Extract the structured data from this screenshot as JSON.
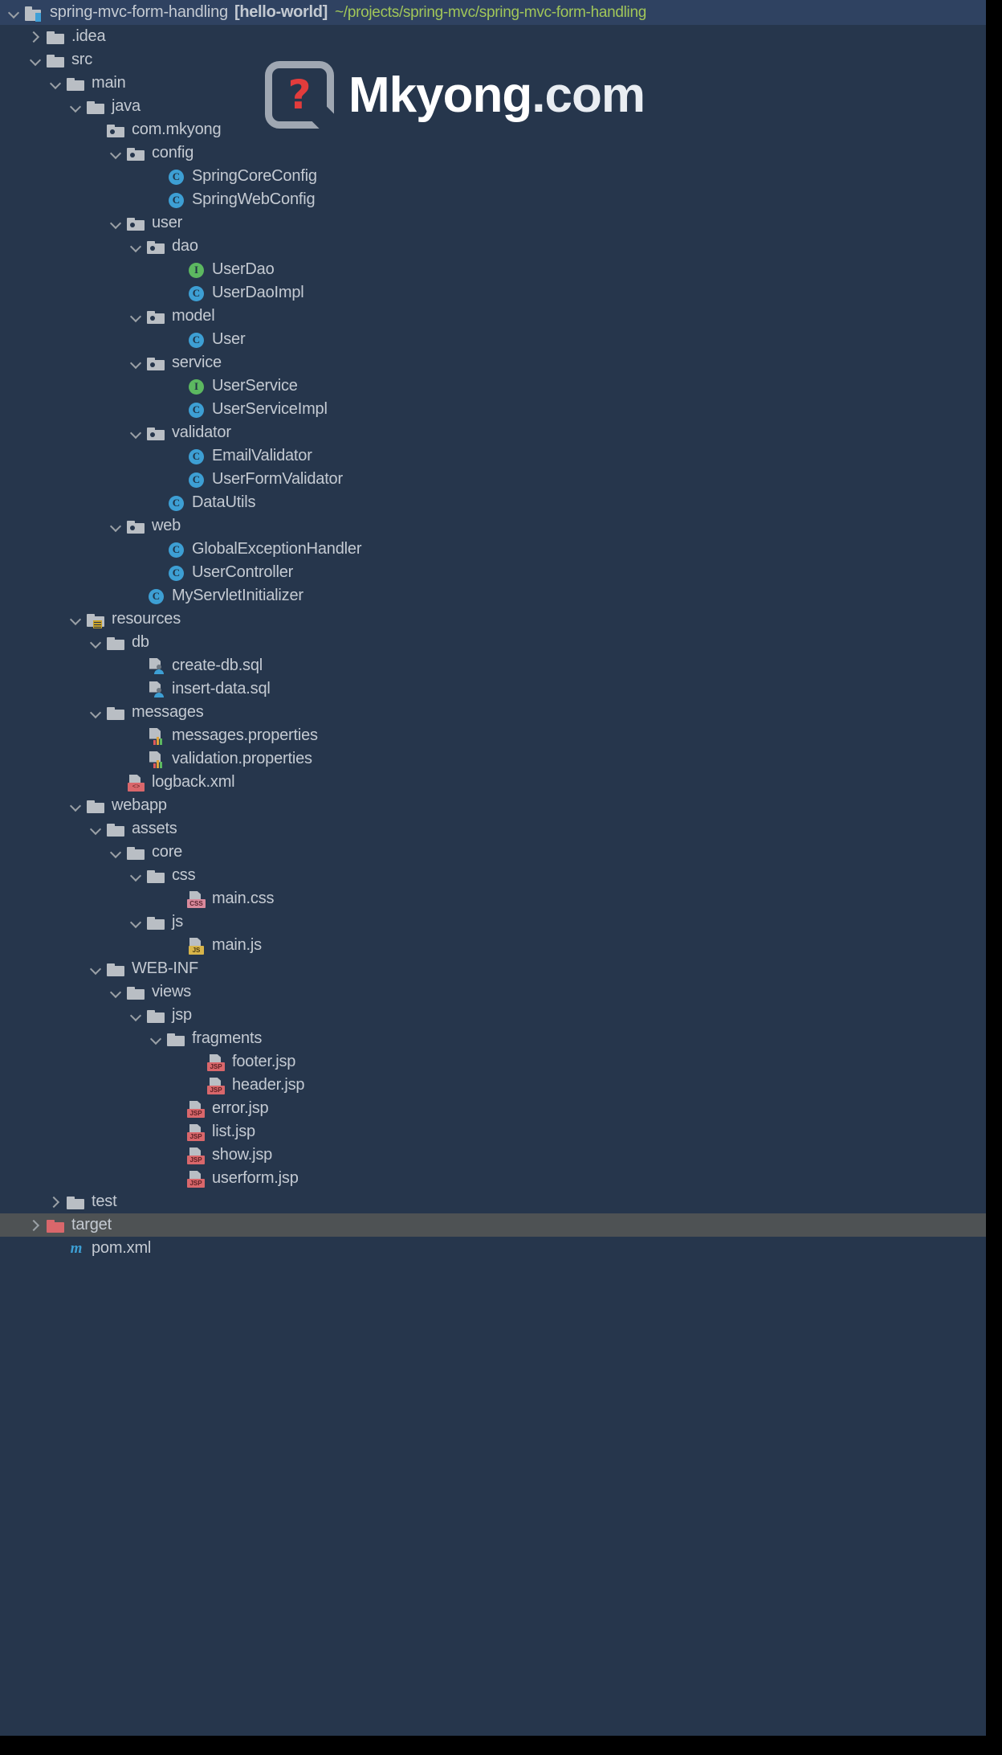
{
  "header": {
    "chevron": "chevron-down",
    "icon": "project-module-icon",
    "project_name": "spring-mvc-form-handling",
    "module": "[hello-world]",
    "path": "~/projects/spring-mvc/spring-mvc-form-handling"
  },
  "watermark": {
    "glyph": "?",
    "brand": "Mkyong",
    "suffix": ".com"
  },
  "colors": {
    "panel_bg": "#26364c",
    "title_bg": "#2f4261",
    "selected_bg": "#4e5254",
    "text": "#c4cad2",
    "path_green": "#a1c659",
    "class_blue": "#3d9fd4",
    "interface_green": "#5cb860",
    "folder_gray": "#b9bec4",
    "target_red": "#d9676b"
  },
  "tree": [
    {
      "label": ".idea",
      "indent": 1,
      "chevron": "right",
      "icon": "folder",
      "selected": false
    },
    {
      "label": "src",
      "indent": 1,
      "chevron": "down",
      "icon": "folder",
      "selected": false
    },
    {
      "label": "main",
      "indent": 2,
      "chevron": "down",
      "icon": "folder",
      "selected": false
    },
    {
      "label": "java",
      "indent": 3,
      "chevron": "down",
      "icon": "folder",
      "selected": false
    },
    {
      "label": "com.mkyong",
      "indent": 4,
      "chevron": "none",
      "icon": "package",
      "selected": false
    },
    {
      "label": "config",
      "indent": 5,
      "chevron": "down",
      "icon": "package",
      "selected": false
    },
    {
      "label": "SpringCoreConfig",
      "indent": 7,
      "chevron": "none",
      "icon": "class",
      "selected": false
    },
    {
      "label": "SpringWebConfig",
      "indent": 7,
      "chevron": "none",
      "icon": "class",
      "selected": false
    },
    {
      "label": "user",
      "indent": 5,
      "chevron": "down",
      "icon": "package",
      "selected": false
    },
    {
      "label": "dao",
      "indent": 6,
      "chevron": "down",
      "icon": "package",
      "selected": false
    },
    {
      "label": "UserDao",
      "indent": 8,
      "chevron": "none",
      "icon": "interface",
      "selected": false
    },
    {
      "label": "UserDaoImpl",
      "indent": 8,
      "chevron": "none",
      "icon": "class",
      "selected": false
    },
    {
      "label": "model",
      "indent": 6,
      "chevron": "down",
      "icon": "package",
      "selected": false
    },
    {
      "label": "User",
      "indent": 8,
      "chevron": "none",
      "icon": "class",
      "selected": false
    },
    {
      "label": "service",
      "indent": 6,
      "chevron": "down",
      "icon": "package",
      "selected": false
    },
    {
      "label": "UserService",
      "indent": 8,
      "chevron": "none",
      "icon": "interface",
      "selected": false
    },
    {
      "label": "UserServiceImpl",
      "indent": 8,
      "chevron": "none",
      "icon": "class",
      "selected": false
    },
    {
      "label": "validator",
      "indent": 6,
      "chevron": "down",
      "icon": "package",
      "selected": false
    },
    {
      "label": "EmailValidator",
      "indent": 8,
      "chevron": "none",
      "icon": "class",
      "selected": false
    },
    {
      "label": "UserFormValidator",
      "indent": 8,
      "chevron": "none",
      "icon": "class",
      "selected": false
    },
    {
      "label": "DataUtils",
      "indent": 7,
      "chevron": "none",
      "icon": "class",
      "selected": false
    },
    {
      "label": "web",
      "indent": 5,
      "chevron": "down",
      "icon": "package",
      "selected": false
    },
    {
      "label": "GlobalExceptionHandler",
      "indent": 7,
      "chevron": "none",
      "icon": "class",
      "selected": false
    },
    {
      "label": "UserController",
      "indent": 7,
      "chevron": "none",
      "icon": "class",
      "selected": false
    },
    {
      "label": "MyServletInitializer",
      "indent": 6,
      "chevron": "none",
      "icon": "class",
      "selected": false
    },
    {
      "label": "resources",
      "indent": 3,
      "chevron": "down",
      "icon": "resources",
      "selected": false
    },
    {
      "label": "db",
      "indent": 4,
      "chevron": "down",
      "icon": "folder",
      "selected": false
    },
    {
      "label": "create-db.sql",
      "indent": 6,
      "chevron": "none",
      "icon": "sql",
      "selected": false
    },
    {
      "label": "insert-data.sql",
      "indent": 6,
      "chevron": "none",
      "icon": "sql",
      "selected": false
    },
    {
      "label": "messages",
      "indent": 4,
      "chevron": "down",
      "icon": "folder",
      "selected": false
    },
    {
      "label": "messages.properties",
      "indent": 6,
      "chevron": "none",
      "icon": "properties",
      "selected": false
    },
    {
      "label": "validation.properties",
      "indent": 6,
      "chevron": "none",
      "icon": "properties",
      "selected": false
    },
    {
      "label": "logback.xml",
      "indent": 5,
      "chevron": "none",
      "icon": "xml",
      "selected": false
    },
    {
      "label": "webapp",
      "indent": 3,
      "chevron": "down",
      "icon": "folder",
      "selected": false
    },
    {
      "label": "assets",
      "indent": 4,
      "chevron": "down",
      "icon": "folder",
      "selected": false
    },
    {
      "label": "core",
      "indent": 5,
      "chevron": "down",
      "icon": "folder",
      "selected": false
    },
    {
      "label": "css",
      "indent": 6,
      "chevron": "down",
      "icon": "folder",
      "selected": false
    },
    {
      "label": "main.css",
      "indent": 8,
      "chevron": "none",
      "icon": "css",
      "selected": false
    },
    {
      "label": "js",
      "indent": 6,
      "chevron": "down",
      "icon": "folder",
      "selected": false
    },
    {
      "label": "main.js",
      "indent": 8,
      "chevron": "none",
      "icon": "js",
      "selected": false
    },
    {
      "label": "WEB-INF",
      "indent": 4,
      "chevron": "down",
      "icon": "folder",
      "selected": false
    },
    {
      "label": "views",
      "indent": 5,
      "chevron": "down",
      "icon": "folder",
      "selected": false
    },
    {
      "label": "jsp",
      "indent": 6,
      "chevron": "down",
      "icon": "folder",
      "selected": false
    },
    {
      "label": "fragments",
      "indent": 7,
      "chevron": "down",
      "icon": "folder",
      "selected": false
    },
    {
      "label": "footer.jsp",
      "indent": 9,
      "chevron": "none",
      "icon": "jsp",
      "selected": false
    },
    {
      "label": "header.jsp",
      "indent": 9,
      "chevron": "none",
      "icon": "jsp",
      "selected": false
    },
    {
      "label": "error.jsp",
      "indent": 8,
      "chevron": "none",
      "icon": "jsp",
      "selected": false
    },
    {
      "label": "list.jsp",
      "indent": 8,
      "chevron": "none",
      "icon": "jsp",
      "selected": false
    },
    {
      "label": "show.jsp",
      "indent": 8,
      "chevron": "none",
      "icon": "jsp",
      "selected": false
    },
    {
      "label": "userform.jsp",
      "indent": 8,
      "chevron": "none",
      "icon": "jsp",
      "selected": false
    },
    {
      "label": "test",
      "indent": 2,
      "chevron": "right",
      "icon": "folder",
      "selected": false
    },
    {
      "label": "target",
      "indent": 1,
      "chevron": "right",
      "icon": "target",
      "selected": true
    },
    {
      "label": "pom.xml",
      "indent": 2,
      "chevron": "none",
      "icon": "maven",
      "selected": false
    }
  ]
}
